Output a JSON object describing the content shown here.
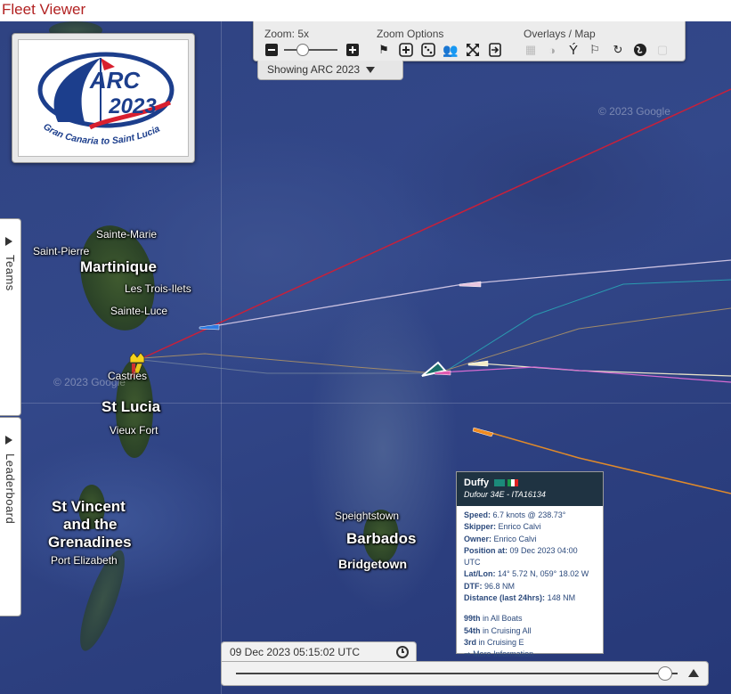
{
  "page": {
    "title": "Fleet Viewer"
  },
  "logo": {
    "event": "ARC",
    "year": "2023",
    "route": "Gran Canaria to Saint Lucia"
  },
  "toolbar": {
    "zoom_label": "Zoom: 5x",
    "zoom_level": 5,
    "zoom_options_label": "Zoom Options",
    "overlays_label": "Overlays / Map",
    "zoom_out_icon": "minus-icon",
    "zoom_in_icon": "plus-icon",
    "zoom_buttons": [
      "flag-icon",
      "zoom-fit-icon",
      "dice-icon",
      "group-icon",
      "expand-icon",
      "enter-icon"
    ],
    "overlay_buttons": [
      "grid-icon",
      "day-night-icon",
      "wind-icon",
      "flags-icon",
      "refresh-icon",
      "globe-icon",
      "layers-icon"
    ]
  },
  "showing": {
    "label": "Showing ARC 2023"
  },
  "side_tabs": [
    {
      "label": "Teams"
    },
    {
      "label": "Leaderboard"
    }
  ],
  "places": {
    "martinique": "Martinique",
    "sainte_marie": "Sainte-Marie",
    "saint_pierre": "Saint-Pierre",
    "les_trois_ilets": "Les Trois-Ilets",
    "sainte_luce": "Sainte-Luce",
    "castries": "Castries",
    "st_lucia": "St Lucia",
    "vieux_fort": "Vieux Fort",
    "st_vincent_1": "St Vincent",
    "st_vincent_2": "and the",
    "st_vincent_3": "Grenadines",
    "port_elizabeth": "Port Elizabeth",
    "speightstown": "Speightstown",
    "barbados": "Barbados",
    "bridgetown": "Bridgetown"
  },
  "watermark": "© 2023 Google",
  "boat_info": {
    "name": "Duffy",
    "boat_type": "Dufour 34E - ITA16134",
    "speed_label": "Speed:",
    "speed": "6.7 knots @ 238.73°",
    "skipper_label": "Skipper:",
    "skipper": "Enrico Calvi",
    "owner_label": "Owner:",
    "owner": "Enrico Calvi",
    "position_label": "Position at:",
    "position_time": "09 Dec 2023 04:00 UTC",
    "latlon_label": "Lat/Lon:",
    "latlon": "14° 5.72 N, 059° 18.02 W",
    "dtf_label": "DTF:",
    "dtf": "96.8 NM",
    "distance_label": "Distance (last 24hrs):",
    "distance": "148 NM",
    "rank_all": "99th",
    "rank_all_label": "in All Boats",
    "rank_class": "54th",
    "rank_class_label": "in Cruising All",
    "rank_div": "3rd",
    "rank_div_label": "in Cruising E",
    "more_info": "More Information"
  },
  "timebar": {
    "timestamp": "09 Dec 2023 05:15:02 UTC",
    "clock_icon": "clock-icon",
    "progress": 0.97
  },
  "colors": {
    "title": "#b22222",
    "info_header": "#1f3342",
    "info_text": "#2c4a7c",
    "ocean": "#2f4382"
  }
}
